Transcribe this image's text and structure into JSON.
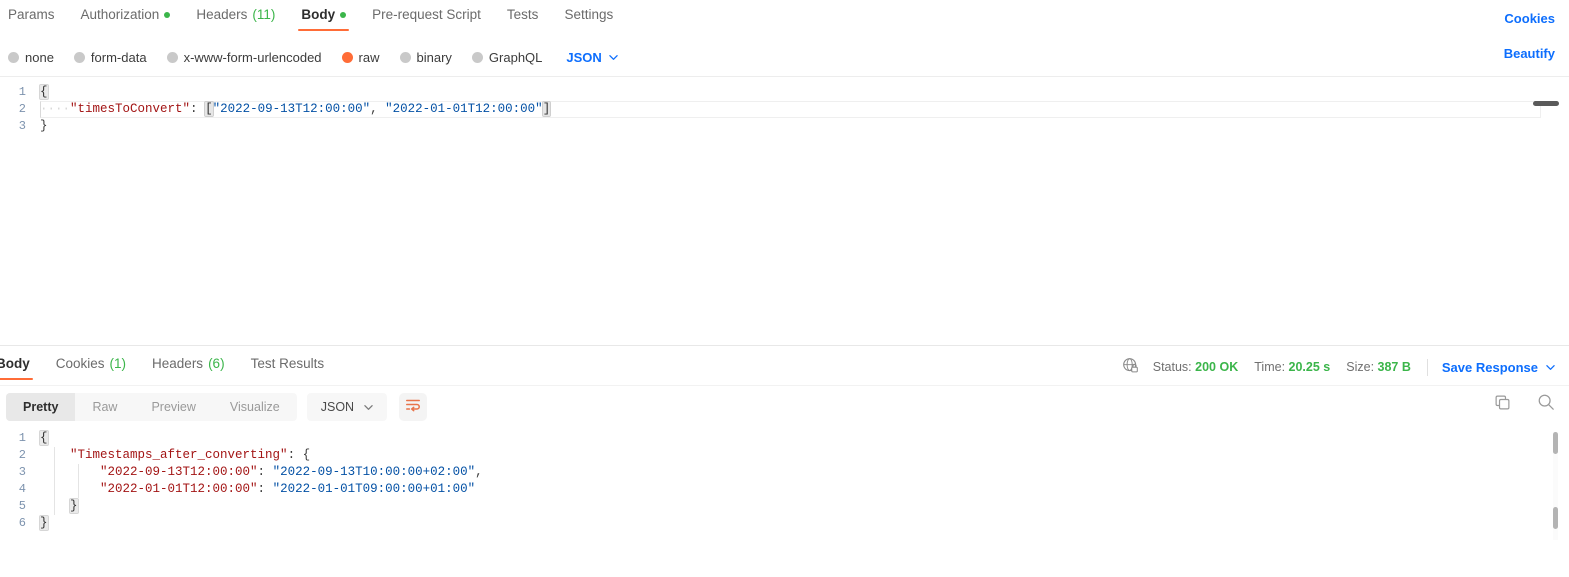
{
  "request": {
    "tabs": [
      {
        "label": "Params",
        "badge": "",
        "badge_type": "none",
        "active": false
      },
      {
        "label": "Authorization",
        "badge": "",
        "badge_type": "dot",
        "active": false
      },
      {
        "label": "Headers",
        "badge": "(11)",
        "badge_type": "count",
        "active": false
      },
      {
        "label": "Body",
        "badge": "",
        "badge_type": "dot",
        "active": true
      },
      {
        "label": "Pre-request Script",
        "badge": "",
        "badge_type": "none",
        "active": false
      },
      {
        "label": "Tests",
        "badge": "",
        "badge_type": "none",
        "active": false
      },
      {
        "label": "Settings",
        "badge": "",
        "badge_type": "none",
        "active": false
      }
    ],
    "cookies_link": "Cookies",
    "beautify_link": "Beautify",
    "body_types": [
      {
        "label": "none",
        "selected": false
      },
      {
        "label": "form-data",
        "selected": false
      },
      {
        "label": "x-www-form-urlencoded",
        "selected": false
      },
      {
        "label": "raw",
        "selected": true
      },
      {
        "label": "binary",
        "selected": false
      },
      {
        "label": "GraphQL",
        "selected": false
      }
    ],
    "format_selected": "JSON",
    "body_lines": [
      {
        "n": "1",
        "segments": [
          {
            "t": "{",
            "c": "brace-hl"
          }
        ]
      },
      {
        "n": "2",
        "active": true,
        "segments": [
          {
            "t": "····",
            "c": "tok-ws"
          },
          {
            "t": "\"timesToConvert\"",
            "c": "tok-key"
          },
          {
            "t": ":",
            "c": "tok-punct"
          },
          {
            "t": " ",
            "c": "tok-punct"
          },
          {
            "t": "[",
            "c": "bracket-hl"
          },
          {
            "t": "\"2022-09-13T12:00:00\"",
            "c": "tok-str"
          },
          {
            "t": ",",
            "c": "tok-punct"
          },
          {
            "t": " ",
            "c": "tok-punct"
          },
          {
            "t": "\"2022-01-01T12:00:00\"",
            "c": "tok-str"
          },
          {
            "t": "]",
            "c": "bracket-hl"
          }
        ]
      },
      {
        "n": "3",
        "segments": [
          {
            "t": "}",
            "c": "tok-punct"
          }
        ]
      }
    ]
  },
  "response": {
    "tabs": [
      {
        "label": "Body",
        "badge": "",
        "badge_type": "none",
        "active": true
      },
      {
        "label": "Cookies",
        "badge": "(1)",
        "badge_type": "count",
        "active": false
      },
      {
        "label": "Headers",
        "badge": "(6)",
        "badge_type": "count",
        "active": false
      },
      {
        "label": "Test Results",
        "badge": "",
        "badge_type": "none",
        "active": false
      }
    ],
    "meta": {
      "status_label": "Status:",
      "status_value": "200 OK",
      "time_label": "Time:",
      "time_value": "20.25 s",
      "size_label": "Size:",
      "size_value": "387 B",
      "save_response": "Save Response"
    },
    "view_modes": [
      {
        "label": "Pretty",
        "active": true
      },
      {
        "label": "Raw",
        "active": false
      },
      {
        "label": "Preview",
        "active": false
      },
      {
        "label": "Visualize",
        "active": false
      }
    ],
    "format_selected": "JSON",
    "body_lines": [
      {
        "n": "1",
        "segments": [
          {
            "t": "{",
            "c": "brace-hl"
          }
        ]
      },
      {
        "n": "2",
        "segments": [
          {
            "t": "    ",
            "c": "tok-punct"
          },
          {
            "t": "\"Timestamps_after_converting\"",
            "c": "tok-key"
          },
          {
            "t": ": {",
            "c": "tok-punct"
          }
        ]
      },
      {
        "n": "3",
        "segments": [
          {
            "t": "        ",
            "c": "tok-punct"
          },
          {
            "t": "\"2022-09-13T12:00:00\"",
            "c": "tok-key"
          },
          {
            "t": ": ",
            "c": "tok-punct"
          },
          {
            "t": "\"2022-09-13T10:00:00+02:00\"",
            "c": "tok-str"
          },
          {
            "t": ",",
            "c": "tok-punct"
          }
        ]
      },
      {
        "n": "4",
        "segments": [
          {
            "t": "        ",
            "c": "tok-punct"
          },
          {
            "t": "\"2022-01-01T12:00:00\"",
            "c": "tok-key"
          },
          {
            "t": ": ",
            "c": "tok-punct"
          },
          {
            "t": "\"2022-01-01T09:00:00+01:00\"",
            "c": "tok-str"
          }
        ]
      },
      {
        "n": "5",
        "segments": [
          {
            "t": "    ",
            "c": "tok-punct"
          },
          {
            "t": "}",
            "c": "brace-hl"
          }
        ]
      },
      {
        "n": "6",
        "segments": [
          {
            "t": "}",
            "c": "brace-hl"
          }
        ]
      }
    ]
  },
  "colors": {
    "accent_orange": "#ff6c37",
    "link_blue": "#0d6efd",
    "success_green": "#3bb54a",
    "json_key": "#a31515",
    "json_string": "#0451a5"
  }
}
